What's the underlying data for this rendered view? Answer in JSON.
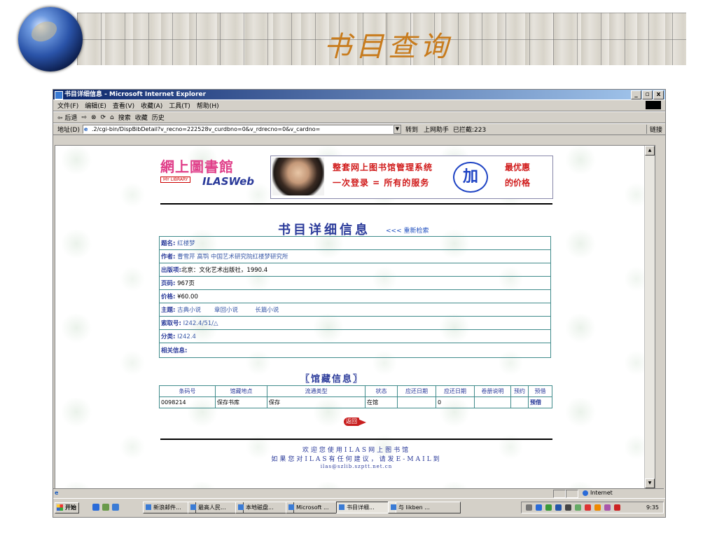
{
  "slide": {
    "title": "书目查询"
  },
  "window": {
    "title": "书目详细信息 - Microsoft Internet Explorer",
    "controls": [
      "_",
      "▫",
      "x"
    ]
  },
  "menu": [
    "文件(F)",
    "编辑(E)",
    "查看(V)",
    "收藏(A)",
    "工具(T)",
    "帮助(H)"
  ],
  "toolbar": {
    "back": "⇦ 后退",
    "forward": "⇨",
    "stop": "⊗",
    "refresh": "⟳",
    "home": "⌂",
    "search": "搜索",
    "favorites": "收藏",
    "history": "历史"
  },
  "addressbar": {
    "label": "地址(D)",
    "url": ".2/cgi-bin/DispBibDetail?v_recno=222528v_curdbno=0&v_rdrecno=0&v_cardno=",
    "go": "转到",
    "helper": "上网助手",
    "blocked": "已拦截:223",
    "links": "链接"
  },
  "page": {
    "logo_cn": "網上圖書館",
    "logo_en": "MY LIBRARY",
    "logo_ilas": "ILASWeb",
    "ad_line1": "整套网上图书馆管理系统",
    "ad_line2": "一次登录  =  所有的服务",
    "ad_plus": "加",
    "ad_right1": "最优惠",
    "ad_right2": "的价格",
    "detail_title": "书目详细信息",
    "re_search": "<<< 重新检索",
    "holdings_title": "〖馆藏信息〗",
    "return": "返回",
    "footer1": "欢迎您使用ILAS网上图书馆",
    "footer2": "如果您对ILAS有任何建议，请发E-MAIL到",
    "footer3": "ilas@szlib.szptt.net.cn"
  },
  "book": {
    "title_label": "题名:",
    "title": "红楼梦",
    "author_label": "作者:",
    "author": "曹雪芹  高鹗  中国艺术研究院红楼梦研究所",
    "publisher_label": "出版项:",
    "publisher": "北京：文化艺术出版社，1990.4",
    "pages_label": "页码:",
    "pages": "967页",
    "price_label": "价格:",
    "price": "¥60.00",
    "subject_label": "主题:",
    "subjects": [
      "古典小说",
      "章回小说",
      "长篇小说"
    ],
    "callno_label": "索取号:",
    "callno": "I242.4/51/△",
    "class_label": "分类:",
    "class": "I242.4",
    "related_label": "相关信息:"
  },
  "holdings": {
    "headers": [
      "条码号",
      "馆藏地点",
      "流通类型",
      "状态",
      "应还日期",
      "应还日期",
      "卷册说明",
      "预约",
      "预借"
    ],
    "row": [
      "0098214",
      "保存书库",
      "保存",
      "在馆",
      "",
      "0",
      "",
      "",
      "预借"
    ]
  },
  "statusbar": {
    "icon": "e",
    "zone": "Internet"
  },
  "taskbar": {
    "start": "开始",
    "buttons": [
      "新浪邮件...",
      "最高人民...",
      "本地磁盘...",
      "Microsoft ...",
      "书目详细...",
      "与 likben ..."
    ],
    "clock": "9:35"
  }
}
